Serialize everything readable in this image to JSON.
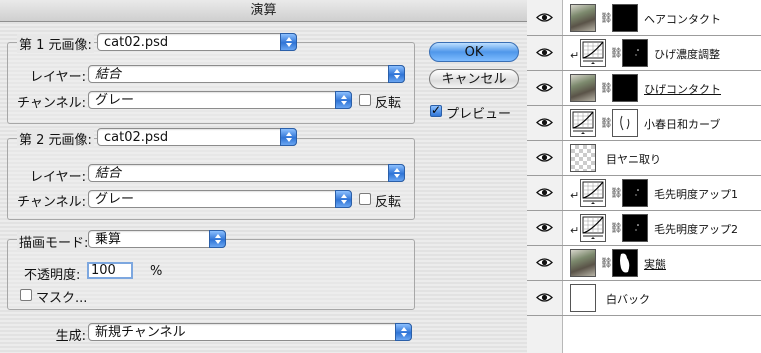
{
  "dialog": {
    "title": "演算",
    "source1": {
      "label": "第 1 元画像:",
      "file": "cat02.psd",
      "layer_label": "レイヤー:",
      "layer_value": "結合",
      "channel_label": "チャンネル:",
      "channel_value": "グレー",
      "invert_label": "反転",
      "invert_checked": false
    },
    "source2": {
      "label": "第 2 元画像:",
      "file": "cat02.psd",
      "layer_label": "レイヤー:",
      "layer_value": "結合",
      "channel_label": "チャンネル:",
      "channel_value": "グレー",
      "invert_label": "反転",
      "invert_checked": false
    },
    "blend": {
      "mode_label": "描画モード:",
      "mode_value": "乗算",
      "opacity_label": "不透明度:",
      "opacity_value": "100",
      "opacity_unit": "%",
      "mask_label": "マスク...",
      "mask_checked": false
    },
    "result": {
      "label": "生成:",
      "value": "新規チャンネル"
    },
    "buttons": {
      "ok": "OK",
      "cancel": "キャンセル"
    },
    "preview_label": "プレビュー",
    "preview_checked": true
  },
  "layers": [
    {
      "name": "ヘアコンタクト",
      "thumb": "photo",
      "mask": "black",
      "clipped": false,
      "underline": false
    },
    {
      "name": "ひげ濃度調整",
      "thumb": "curve",
      "mask": "black-speck",
      "clipped": true,
      "underline": false
    },
    {
      "name": "ひげコンタクト",
      "thumb": "photo",
      "mask": "black",
      "clipped": false,
      "underline": true
    },
    {
      "name": "小春日和カーブ",
      "thumb": "curve",
      "mask": "white-outline",
      "clipped": false,
      "underline": false
    },
    {
      "name": "目ヤニ取り",
      "thumb": "checker",
      "mask": "none",
      "clipped": false,
      "underline": false
    },
    {
      "name": "毛先明度アップ1",
      "thumb": "curve",
      "mask": "black-speck",
      "clipped": true,
      "underline": false
    },
    {
      "name": "毛先明度アップ2",
      "thumb": "curve",
      "mask": "black-speck",
      "clipped": true,
      "underline": false
    },
    {
      "name": "実態",
      "thumb": "photo",
      "mask": "white-shape",
      "clipped": false,
      "underline": true
    },
    {
      "name": "白バック",
      "thumb": "white",
      "mask": "none",
      "clipped": false,
      "underline": false
    }
  ],
  "icons": {
    "visibility": "eye-icon",
    "link": "chain-icon",
    "clip": "clip-arrow-icon",
    "popup": "updown-arrows-icon"
  },
  "colors": {
    "accent": "#2f74d6",
    "panel_bg": "#ececec"
  }
}
